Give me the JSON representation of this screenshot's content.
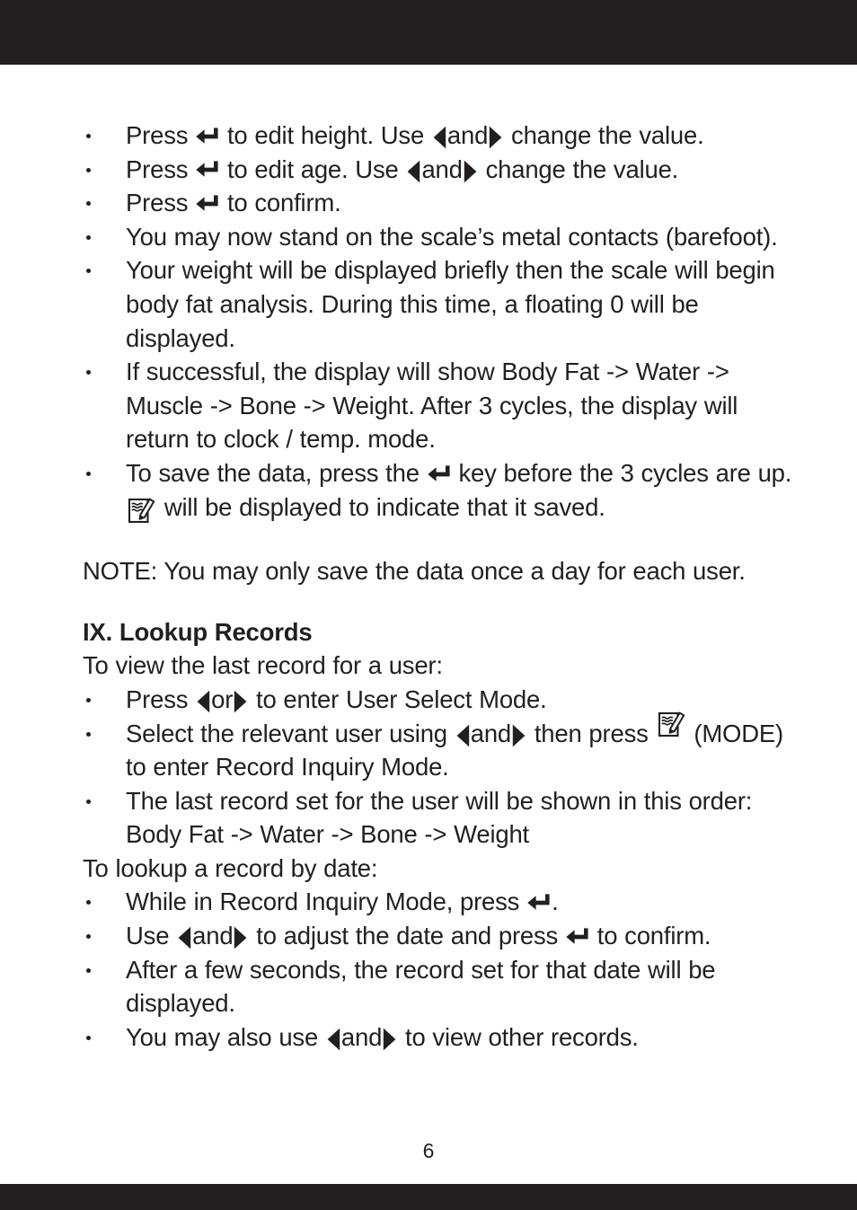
{
  "page": {
    "number": "6",
    "bar_color": "#231F20",
    "text_color": "#231F20",
    "background": "#ffffff"
  },
  "icons": {
    "enter_key": "enter-key-arrow-icon",
    "left_arrow": "left-triangle-arrow-icon",
    "right_arrow": "right-triangle-arrow-icon",
    "memo": "memo-save-icon"
  },
  "sections": [
    {
      "id": "instructions-measure",
      "bullets": [
        {
          "id": "bullet-edit-height",
          "parts": [
            {
              "t": "text",
              "v": "Press "
            },
            {
              "t": "icon",
              "v": "enter_key"
            },
            {
              "t": "text",
              "v": " to edit height. Use "
            },
            {
              "t": "icon",
              "v": "left_arrow"
            },
            {
              "t": "text",
              "v": "and"
            },
            {
              "t": "icon",
              "v": "right_arrow"
            },
            {
              "t": "text",
              "v": " change the value."
            }
          ],
          "plain": "Press ⏎ to edit height. Use ◀ and ▶ change the value."
        },
        {
          "id": "bullet-edit-age",
          "parts": [
            {
              "t": "text",
              "v": "Press "
            },
            {
              "t": "icon",
              "v": "enter_key"
            },
            {
              "t": "text",
              "v": " to edit age. Use "
            },
            {
              "t": "icon",
              "v": "left_arrow"
            },
            {
              "t": "text",
              "v": "and"
            },
            {
              "t": "icon",
              "v": "right_arrow"
            },
            {
              "t": "text",
              "v": " change the value."
            }
          ],
          "plain": "Press ⏎ to edit age. Use ◀ and ▶ change the value."
        },
        {
          "id": "bullet-confirm",
          "parts": [
            {
              "t": "text",
              "v": "Press "
            },
            {
              "t": "icon",
              "v": "enter_key"
            },
            {
              "t": "text",
              "v": " to confirm."
            }
          ],
          "plain": "Press ⏎ to confirm."
        },
        {
          "id": "bullet-stand-on-scale",
          "parts": [
            {
              "t": "text",
              "v": "You may now stand on the scale’s metal contacts (barefoot)."
            }
          ],
          "plain": "You may now stand on the scale’s metal contacts (barefoot)."
        },
        {
          "id": "bullet-weight-displayed",
          "parts": [
            {
              "t": "text",
              "v": "Your weight will be displayed briefly then the scale will begin body fat analysis. During this time, a floating 0 will be displayed."
            }
          ],
          "plain": "Your weight will be displayed briefly then the scale will begin body fat analysis. During this time, a floating 0 will be displayed."
        },
        {
          "id": "bullet-display-cycle",
          "parts": [
            {
              "t": "text",
              "v": "If successful, the display will show Body Fat -> Water -> Muscle -> Bone -> Weight. After 3 cycles, the display will return to clock / temp. mode."
            }
          ],
          "plain": "If successful, the display will show Body Fat -> Water -> Muscle -> Bone -> Weight. After 3 cycles, the display will return to clock / temp. mode."
        },
        {
          "id": "bullet-save-data",
          "parts": [
            {
              "t": "text",
              "v": "To save the data, press the "
            },
            {
              "t": "icon",
              "v": "enter_key"
            },
            {
              "t": "text",
              "v": " key before the 3 cycles are up. "
            },
            {
              "t": "icon",
              "v": "memo"
            },
            {
              "t": "text",
              "v": " will be displayed to indicate that it saved."
            }
          ],
          "plain": "To save the data, press the ⏎ key before the 3 cycles are up. 📝 will be displayed to indicate that it saved."
        }
      ]
    }
  ],
  "note": {
    "label": "NOTE:",
    "text": " You may only save the data once a day for each user."
  },
  "lookup_section": {
    "heading": "IX. Lookup Records",
    "intro_view": "To view the last record for a user:",
    "view_bullets": [
      {
        "id": "bullet-user-select-mode",
        "parts": [
          {
            "t": "text",
            "v": "Press  "
          },
          {
            "t": "icon",
            "v": "left_arrow"
          },
          {
            "t": "text",
            "v": "or"
          },
          {
            "t": "icon",
            "v": "right_arrow"
          },
          {
            "t": "text",
            "v": " to enter User Select Mode."
          }
        ],
        "plain": "Press ◀ or ▶ to enter User Select Mode."
      },
      {
        "id": "bullet-record-inquiry-mode",
        "parts": [
          {
            "t": "text",
            "v": "Select the relevant user using "
          },
          {
            "t": "icon",
            "v": "left_arrow"
          },
          {
            "t": "text",
            "v": "and"
          },
          {
            "t": "icon",
            "v": "right_arrow"
          },
          {
            "t": "text",
            "v": " then press "
          },
          {
            "t": "icon",
            "v": "memo_raised"
          },
          {
            "t": "text",
            "v": " (MODE) to enter Record Inquiry Mode."
          }
        ],
        "plain": "Select the relevant user using ◀ and ▶ then press 📝 (MODE) to enter Record Inquiry Mode."
      },
      {
        "id": "bullet-last-record-order",
        "parts": [
          {
            "t": "text",
            "v": "The last record set for the user will be shown in this order: Body Fat -> Water -> Bone -> Weight"
          }
        ],
        "plain": "The last record set for the user will be shown in this order: Body Fat -> Water -> Bone -> Weight"
      }
    ],
    "intro_date": "To lookup a record by date:",
    "date_bullets": [
      {
        "id": "bullet-press-enter-in-inquiry",
        "parts": [
          {
            "t": "text",
            "v": "While in Record Inquiry Mode, press "
          },
          {
            "t": "icon",
            "v": "enter_key"
          },
          {
            "t": "text",
            "v": "."
          }
        ],
        "plain": "While in Record Inquiry Mode, press ⏎."
      },
      {
        "id": "bullet-adjust-date",
        "parts": [
          {
            "t": "text",
            "v": "Use "
          },
          {
            "t": "icon",
            "v": "left_arrow"
          },
          {
            "t": "text",
            "v": "and"
          },
          {
            "t": "icon",
            "v": "right_arrow"
          },
          {
            "t": "text",
            "v": " to adjust the date and press "
          },
          {
            "t": "icon",
            "v": "enter_key"
          },
          {
            "t": "text",
            "v": " to confirm."
          }
        ],
        "plain": "Use ◀ and ▶ to adjust the date and press ⏎ to confirm."
      },
      {
        "id": "bullet-record-shown-after-seconds",
        "parts": [
          {
            "t": "text",
            "v": "After a few seconds, the record set for that date will be displayed."
          }
        ],
        "plain": "After a few seconds, the record set for that date will be displayed."
      },
      {
        "id": "bullet-view-other-records",
        "parts": [
          {
            "t": "text",
            "v": "You may also use "
          },
          {
            "t": "icon",
            "v": "left_arrow"
          },
          {
            "t": "text",
            "v": "and"
          },
          {
            "t": "icon",
            "v": "right_arrow"
          },
          {
            "t": "text",
            "v": " to view other records."
          }
        ],
        "plain": "You may also use ◀ and ▶ to view other records."
      }
    ]
  }
}
